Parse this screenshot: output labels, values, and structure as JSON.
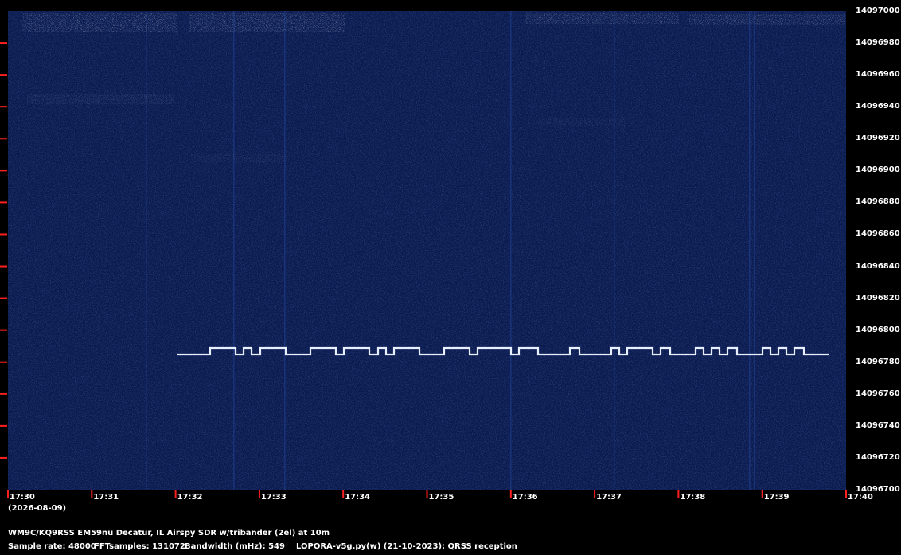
{
  "colors": {
    "background": "#000000",
    "waterfall": "#0b1a4e",
    "noise": "#1d3a86",
    "signal": "#e8f0ff",
    "tick": "#ff2020",
    "text": "#ffffff"
  },
  "frequency_axis": {
    "labels": [
      "14097000",
      "14096980",
      "14096960",
      "14096940",
      "14096920",
      "14096900",
      "14096880",
      "14096860",
      "14096840",
      "14096820",
      "14096800",
      "14096780",
      "14096760",
      "14096740",
      "14096720",
      "14096700"
    ]
  },
  "time_axis": {
    "labels": [
      "17:30",
      "17:31",
      "17:32",
      "17:33",
      "17:34",
      "17:35",
      "17:36",
      "17:37",
      "17:38",
      "17:39",
      "17:40"
    ],
    "date": "(2026-08-09)"
  },
  "footer": {
    "station": "WM9C/KQ9RSS EM59nu Decatur, IL  Airspy SDR w/tribander (2el) at 10m",
    "sample_rate": "Sample rate: 48000",
    "fft_samples": "FFTsamples: 131072",
    "bandwidth": "Bandwidth (mHz): 549",
    "software": "LOPORA-v5g.py(w) (21-10-2023): QRSS reception"
  }
}
